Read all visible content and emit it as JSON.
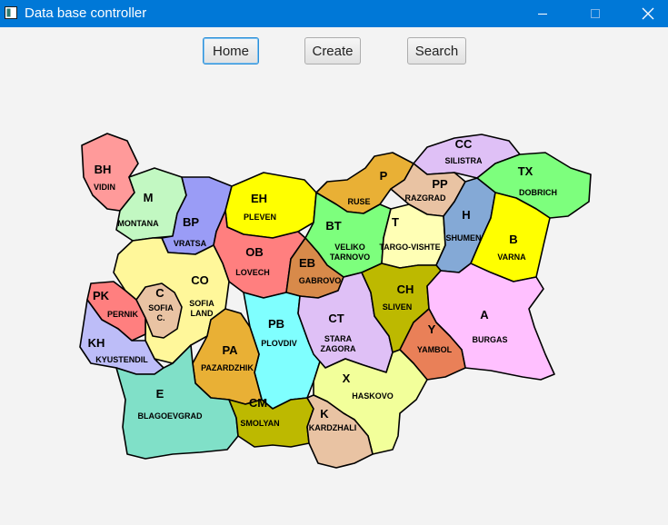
{
  "window": {
    "title": "Data base controller"
  },
  "buttons": {
    "home": "Home",
    "create": "Create",
    "search": "Search"
  },
  "regions": [
    {
      "code": "BH",
      "name": "VIDIN",
      "color": "#ff9a9a"
    },
    {
      "code": "M",
      "name": "MONTANA",
      "color": "#c2f8c2"
    },
    {
      "code": "BP",
      "name": "VRATSA",
      "color": "#9a9cf6"
    },
    {
      "code": "EH",
      "name": "PLEVEN",
      "color": "#ffff00"
    },
    {
      "code": "P",
      "name": "RUSE",
      "color": "#e9b035"
    },
    {
      "code": "CC",
      "name": "SILISTRA",
      "color": "#dfc0f6"
    },
    {
      "code": "PP",
      "name": "RAZGRAD",
      "color": "#e9c3a3"
    },
    {
      "code": "TX",
      "name": "DOBRICH",
      "color": "#7dff7d"
    },
    {
      "code": "BT",
      "name": "VELIKO TARNOVO",
      "color": "#7dff7d"
    },
    {
      "code": "T",
      "name": "TARGO-VISHTE",
      "color": "#ffffb5"
    },
    {
      "code": "H",
      "name": "SHUMEN",
      "color": "#84a9d6"
    },
    {
      "code": "B",
      "name": "VARNA",
      "color": "#ffff00"
    },
    {
      "code": "OB",
      "name": "LOVECH",
      "color": "#ff7f7f"
    },
    {
      "code": "EB",
      "name": "GABROVO",
      "color": "#d88a4a"
    },
    {
      "code": "CO",
      "name": "SOFIA LAND",
      "color": "#fff79a"
    },
    {
      "code": "PK",
      "name": "PERNIK",
      "color": "#ff7f7f"
    },
    {
      "code": "C",
      "name": "SOFIA C.",
      "color": "#e9c3a3"
    },
    {
      "code": "KH",
      "name": "KYUSTENDIL",
      "color": "#bdbdf8"
    },
    {
      "code": "PB",
      "name": "PLOVDIV",
      "color": "#7fffff"
    },
    {
      "code": "CT",
      "name": "STARA ZAGORA",
      "color": "#dfc0f6"
    },
    {
      "code": "CH",
      "name": "SLIVEN",
      "color": "#bdb900"
    },
    {
      "code": "A",
      "name": "BURGAS",
      "color": "#ffc0ff"
    },
    {
      "code": "Y",
      "name": "YAMBOL",
      "color": "#e98058"
    },
    {
      "code": "PA",
      "name": "PAZARDZHIK",
      "color": "#e9b035"
    },
    {
      "code": "E",
      "name": "BLAGOEVGRAD",
      "color": "#80e0c8"
    },
    {
      "code": "CM",
      "name": "SMOLYAN",
      "color": "#bdb900"
    },
    {
      "code": "X",
      "name": "HASKOVO",
      "color": "#f2ff9a"
    },
    {
      "code": "K",
      "name": "KARDZHALI",
      "color": "#e9c3a3"
    }
  ]
}
